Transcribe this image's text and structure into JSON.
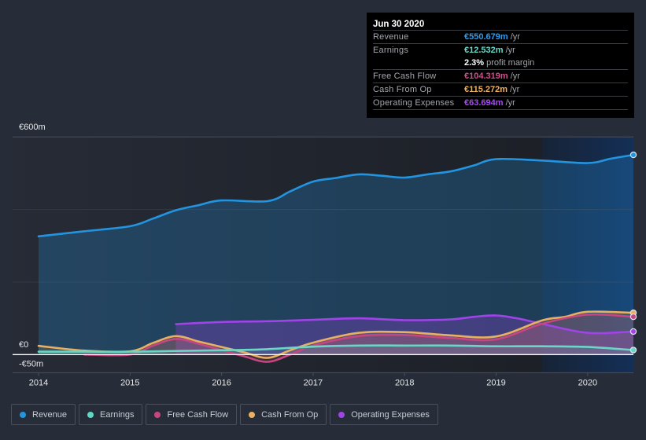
{
  "tooltip": {
    "date": "Jun 30 2020",
    "rows": [
      {
        "label": "Revenue",
        "value": "€550.679m",
        "unit": "/yr",
        "color": "#2a9df4"
      },
      {
        "label": "Earnings",
        "value": "€12.532m",
        "unit": "/yr",
        "color": "#6ad8c6"
      },
      {
        "label": "",
        "value": "2.3%",
        "unit": "profit margin",
        "color": "#ffffff"
      },
      {
        "label": "Free Cash Flow",
        "value": "€104.319m",
        "unit": "/yr",
        "color": "#d04f8c"
      },
      {
        "label": "Cash From Op",
        "value": "€115.272m",
        "unit": "/yr",
        "color": "#f0b25c"
      },
      {
        "label": "Operating Expenses",
        "value": "€63.694m",
        "unit": "/yr",
        "color": "#a54cf0"
      }
    ]
  },
  "legend": [
    {
      "label": "Revenue",
      "color": "#2394e0"
    },
    {
      "label": "Earnings",
      "color": "#5fd8c4"
    },
    {
      "label": "Free Cash Flow",
      "color": "#c8467f"
    },
    {
      "label": "Cash From Op",
      "color": "#e8b060"
    },
    {
      "label": "Operating Expenses",
      "color": "#a043e8"
    }
  ],
  "chart_data": {
    "type": "area",
    "title": "",
    "xlabel": "",
    "ylabel": "",
    "xlim": [
      2014,
      2020.5
    ],
    "ylim": [
      -50,
      600
    ],
    "x_ticks": [
      "2014",
      "2015",
      "2016",
      "2017",
      "2018",
      "2019",
      "2020"
    ],
    "x_tick_values": [
      2014,
      2015,
      2016,
      2017,
      2018,
      2019,
      2020
    ],
    "y_tick_labels": [
      {
        "label": "€600m",
        "value": 600
      },
      {
        "label": "€0",
        "value": 0
      },
      {
        "label": "-€50m",
        "value": -50
      }
    ],
    "gridlines": [
      0,
      200,
      400,
      600
    ],
    "grid": true,
    "legend_position": "bottom-left",
    "highlight_range": [
      2019.5,
      2020.5
    ],
    "series": [
      {
        "key": "revenue",
        "name": "Revenue",
        "color": "#2394e0",
        "fill": "rgba(35,148,224,0.26)",
        "points": [
          [
            2014,
            326
          ],
          [
            2014.5,
            340
          ],
          [
            2015,
            354
          ],
          [
            2015.25,
            375
          ],
          [
            2015.5,
            398
          ],
          [
            2015.75,
            412
          ],
          [
            2016,
            425
          ],
          [
            2016.5,
            423
          ],
          [
            2016.75,
            450
          ],
          [
            2017,
            477
          ],
          [
            2017.25,
            487
          ],
          [
            2017.5,
            497
          ],
          [
            2017.75,
            493
          ],
          [
            2018,
            488
          ],
          [
            2018.25,
            497
          ],
          [
            2018.5,
            505
          ],
          [
            2018.75,
            521
          ],
          [
            2019,
            539
          ],
          [
            2019.5,
            535
          ],
          [
            2020,
            528
          ],
          [
            2020.25,
            540
          ],
          [
            2020.5,
            550.679
          ]
        ]
      },
      {
        "key": "operating-expenses",
        "name": "Operating Expenses",
        "color": "#a043e8",
        "fill": "rgba(160,67,232,0.28)",
        "points": [
          [
            2015.5,
            84
          ],
          [
            2016,
            90
          ],
          [
            2016.5,
            92
          ],
          [
            2017,
            96
          ],
          [
            2017.5,
            100
          ],
          [
            2018,
            95
          ],
          [
            2018.5,
            97
          ],
          [
            2018.75,
            104
          ],
          [
            2019,
            108
          ],
          [
            2019.25,
            99
          ],
          [
            2019.5,
            85
          ],
          [
            2020,
            60
          ],
          [
            2020.5,
            63.694
          ]
        ]
      },
      {
        "key": "cash-from-op",
        "name": "Cash From Op",
        "color": "#e8b060",
        "fill": "rgba(232,176,96,0.16)",
        "points": [
          [
            2014,
            24
          ],
          [
            2014.5,
            11
          ],
          [
            2015,
            9
          ],
          [
            2015.25,
            32
          ],
          [
            2015.5,
            51
          ],
          [
            2015.75,
            36
          ],
          [
            2016,
            21
          ],
          [
            2016.25,
            6
          ],
          [
            2016.5,
            -9
          ],
          [
            2016.75,
            12
          ],
          [
            2017,
            33
          ],
          [
            2017.5,
            60
          ],
          [
            2018,
            62
          ],
          [
            2018.5,
            53
          ],
          [
            2019,
            50
          ],
          [
            2019.5,
            94
          ],
          [
            2019.75,
            104
          ],
          [
            2020,
            118
          ],
          [
            2020.5,
            115.272
          ]
        ]
      },
      {
        "key": "free-cash-flow",
        "name": "Free Cash Flow",
        "color": "#c8467f",
        "fill": "rgba(200,70,127,0.18)",
        "points": [
          [
            2014.5,
            0
          ],
          [
            2015,
            0
          ],
          [
            2015.25,
            25
          ],
          [
            2015.5,
            43
          ],
          [
            2015.75,
            30
          ],
          [
            2016,
            12
          ],
          [
            2016.25,
            -5
          ],
          [
            2016.5,
            -20
          ],
          [
            2016.75,
            0
          ],
          [
            2017,
            25
          ],
          [
            2017.5,
            51
          ],
          [
            2018,
            54
          ],
          [
            2018.5,
            46
          ],
          [
            2019,
            42
          ],
          [
            2019.5,
            85
          ],
          [
            2020,
            110
          ],
          [
            2020.5,
            104.319
          ]
        ]
      },
      {
        "key": "earnings",
        "name": "Earnings",
        "color": "#6ad6c6",
        "fill": "rgba(106,214,198,0.14)",
        "points": [
          [
            2014,
            8
          ],
          [
            2014.5,
            8
          ],
          [
            2015,
            8
          ],
          [
            2015.5,
            10
          ],
          [
            2016,
            12
          ],
          [
            2016.5,
            15
          ],
          [
            2017,
            22
          ],
          [
            2017.5,
            25
          ],
          [
            2018,
            25
          ],
          [
            2018.5,
            25
          ],
          [
            2019,
            23
          ],
          [
            2019.5,
            23
          ],
          [
            2020,
            21
          ],
          [
            2020.5,
            12.532
          ]
        ]
      }
    ]
  }
}
